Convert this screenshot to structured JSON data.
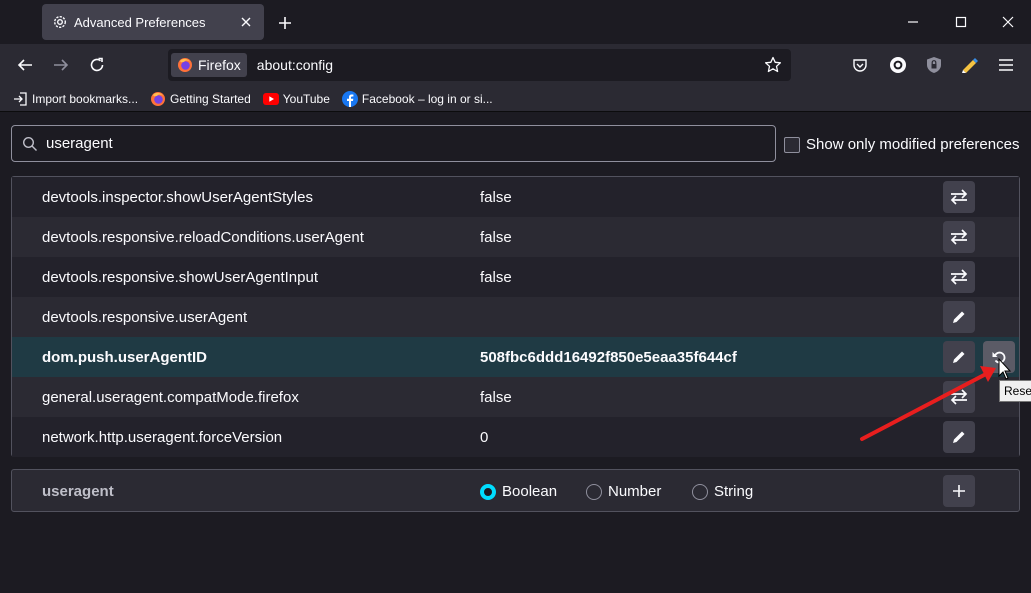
{
  "window": {
    "tab_title": "Advanced Preferences",
    "new_tab": "+",
    "minimize": "—",
    "maximize": "☐",
    "close": "✕"
  },
  "navbar": {
    "identity_label": "Firefox",
    "url": "about:config"
  },
  "bookmarks": [
    {
      "label": "Import bookmarks...",
      "icon": "import-icon"
    },
    {
      "label": "Getting Started",
      "icon": "firefox-icon"
    },
    {
      "label": "YouTube",
      "icon": "youtube-icon"
    },
    {
      "label": "Facebook – log in or si...",
      "icon": "facebook-icon"
    }
  ],
  "search": {
    "value": "useragent",
    "show_modified_label": "Show only modified preferences"
  },
  "prefs": [
    {
      "name": "devtools.inspector.showUserAgentStyles",
      "value": "false",
      "action": "toggle"
    },
    {
      "name": "devtools.responsive.reloadConditions.userAgent",
      "value": "false",
      "action": "toggle"
    },
    {
      "name": "devtools.responsive.showUserAgentInput",
      "value": "false",
      "action": "toggle"
    },
    {
      "name": "devtools.responsive.userAgent",
      "value": "",
      "action": "edit"
    },
    {
      "name": "dom.push.userAgentID",
      "value": "508fbc6ddd16492f850e5eaa35f644cf",
      "action": "edit",
      "modified": true
    },
    {
      "name": "general.useragent.compatMode.firefox",
      "value": "false",
      "action": "toggle"
    },
    {
      "name": "network.http.useragent.forceVersion",
      "value": "0",
      "action": "edit"
    }
  ],
  "new_pref": {
    "name": "useragent",
    "types": [
      "Boolean",
      "Number",
      "String"
    ],
    "selected": "Boolean",
    "add": "+"
  },
  "tooltip": "Reset",
  "colors": {
    "background": "#1c1b22",
    "selected_row": "#1f3a44",
    "radio_accent": "#00ddff",
    "annotation_arrow": "#e81e1e"
  }
}
